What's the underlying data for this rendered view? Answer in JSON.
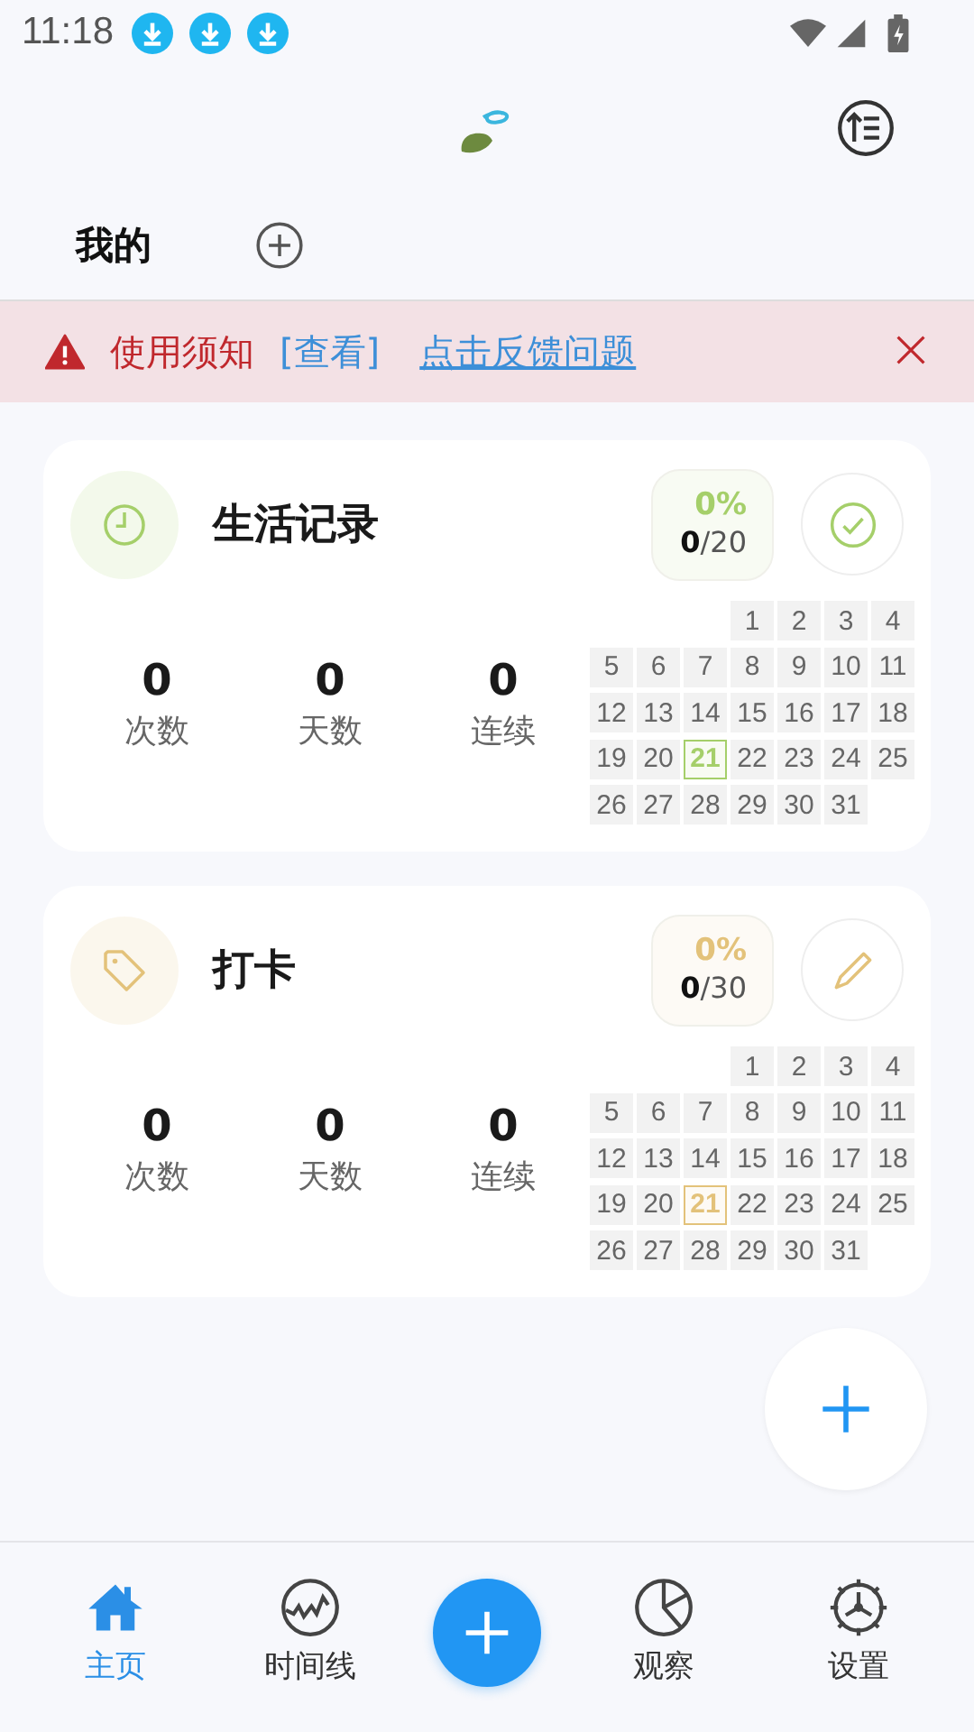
{
  "status_bar": {
    "time": "11:18"
  },
  "tabs": [
    {
      "label": "我的",
      "selected": true
    }
  ],
  "notice": {
    "label": "使用须知",
    "view_link": "[查看]",
    "feedback_link": "点击反馈问题"
  },
  "cards": [
    {
      "title": "生活记录",
      "color": "#a5cf6a",
      "percent": "0%",
      "progress": "**0**/20",
      "stats": [
        {
          "value": "0",
          "label": "次数"
        },
        {
          "value": "0",
          "label": "天数"
        },
        {
          "value": "0",
          "label": "连续"
        }
      ],
      "weeks": [
        [
          {
            "day": "1",
            "today": false
          },
          {
            "day": "2",
            "today": false
          },
          {
            "day": "3",
            "today": false
          },
          {
            "day": "4",
            "today": false
          }
        ],
        [
          {
            "day": "5",
            "today": false
          },
          {
            "day": "6",
            "today": false
          },
          {
            "day": "7",
            "today": false
          },
          {
            "day": "8",
            "today": false
          },
          {
            "day": "9",
            "today": false
          },
          {
            "day": "10",
            "today": false
          },
          {
            "day": "11",
            "today": false
          }
        ],
        [
          {
            "day": "12",
            "today": false
          },
          {
            "day": "13",
            "today": false
          },
          {
            "day": "14",
            "today": false
          },
          {
            "day": "15",
            "today": false
          },
          {
            "day": "16",
            "today": false
          },
          {
            "day": "17",
            "today": false
          },
          {
            "day": "18",
            "today": false
          }
        ],
        [
          {
            "day": "19",
            "today": false
          },
          {
            "day": "20",
            "today": false
          },
          {
            "day": "21",
            "today": true
          },
          {
            "day": "22",
            "today": false
          },
          {
            "day": "23",
            "today": false
          },
          {
            "day": "24",
            "today": false
          },
          {
            "day": "25",
            "today": false
          }
        ],
        [
          {
            "day": "26",
            "today": false
          },
          {
            "day": "27",
            "today": false
          },
          {
            "day": "28",
            "today": false
          },
          {
            "day": "29",
            "today": false
          },
          {
            "day": "30",
            "today": false
          },
          {
            "day": "31",
            "today": false
          }
        ]
      ]
    },
    {
      "title": "打卡",
      "color": "#e3c27a",
      "percent": "0%",
      "progress": "**0**/30",
      "stats": [
        {
          "value": "0",
          "label": "次数"
        },
        {
          "value": "0",
          "label": "天数"
        },
        {
          "value": "0",
          "label": "连续"
        }
      ],
      "weeks": [
        [
          {
            "day": "1",
            "today": false
          },
          {
            "day": "2",
            "today": false
          },
          {
            "day": "3",
            "today": false
          },
          {
            "day": "4",
            "today": false
          }
        ],
        [
          {
            "day": "5",
            "today": false
          },
          {
            "day": "6",
            "today": false
          },
          {
            "day": "7",
            "today": false
          },
          {
            "day": "8",
            "today": false
          },
          {
            "day": "9",
            "today": false
          },
          {
            "day": "10",
            "today": false
          },
          {
            "day": "11",
            "today": false
          }
        ],
        [
          {
            "day": "12",
            "today": false
          },
          {
            "day": "13",
            "today": false
          },
          {
            "day": "14",
            "today": false
          },
          {
            "day": "15",
            "today": false
          },
          {
            "day": "16",
            "today": false
          },
          {
            "day": "17",
            "today": false
          },
          {
            "day": "18",
            "today": false
          }
        ],
        [
          {
            "day": "19",
            "today": false
          },
          {
            "day": "20",
            "today": false
          },
          {
            "day": "21",
            "today": true
          },
          {
            "day": "22",
            "today": false
          },
          {
            "day": "23",
            "today": false
          },
          {
            "day": "24",
            "today": false
          },
          {
            "day": "25",
            "today": false
          }
        ],
        [
          {
            "day": "26",
            "today": false
          },
          {
            "day": "27",
            "today": false
          },
          {
            "day": "28",
            "today": false
          },
          {
            "day": "29",
            "today": false
          },
          {
            "day": "30",
            "today": false
          },
          {
            "day": "31",
            "today": false
          }
        ]
      ]
    }
  ],
  "nav": [
    {
      "kind": "tab",
      "label": "主页",
      "selected": true
    },
    {
      "kind": "tab",
      "label": "时间线",
      "selected": false
    },
    {
      "kind": "fab"
    },
    {
      "kind": "tab",
      "label": "观察",
      "selected": false
    },
    {
      "kind": "tab",
      "label": "设置",
      "selected": false
    }
  ]
}
